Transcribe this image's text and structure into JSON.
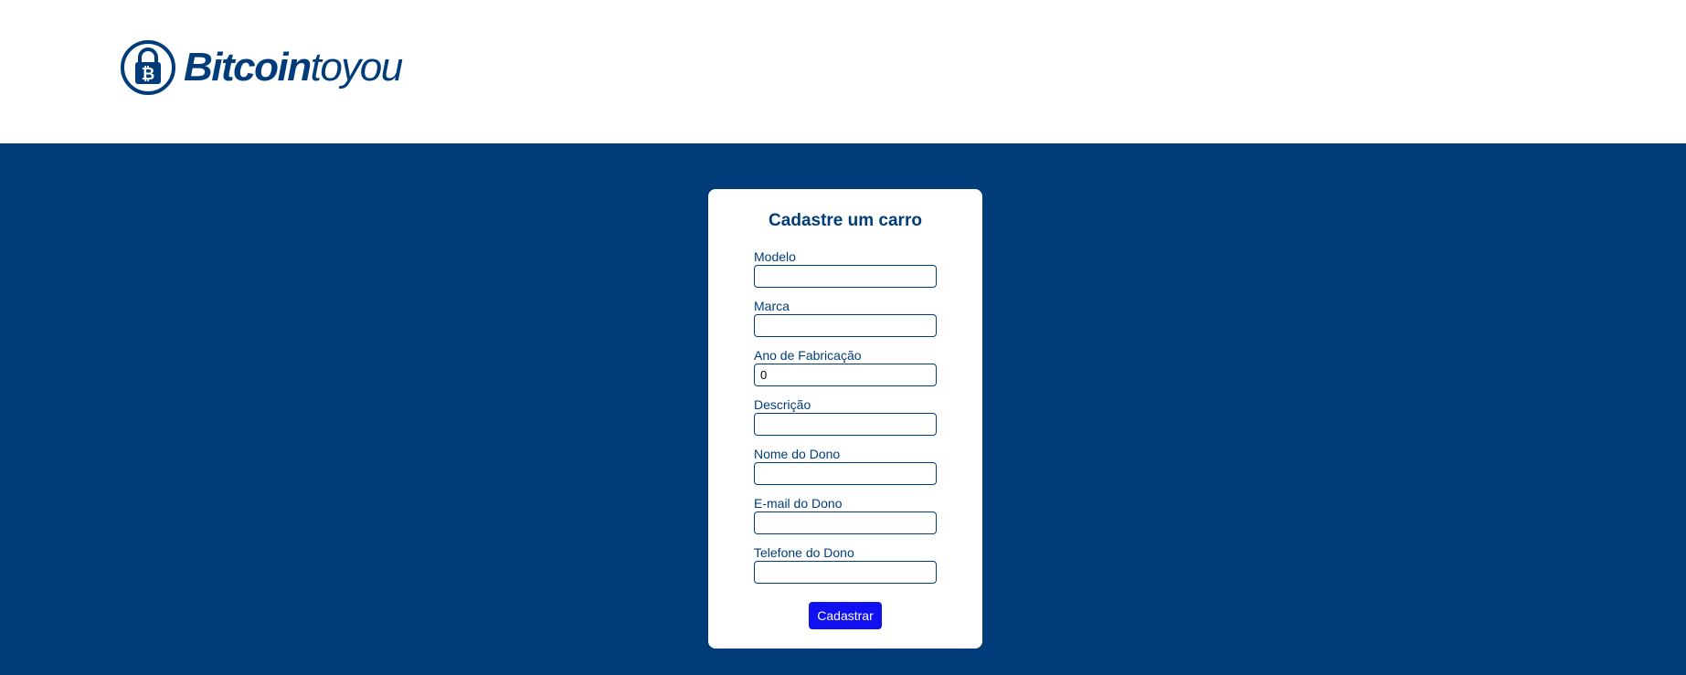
{
  "brand": {
    "name_bold": "Bitcoin",
    "name_light": "toyou",
    "color": "#003c79"
  },
  "form": {
    "title": "Cadastre um carro",
    "fields": [
      {
        "label": "Modelo",
        "value": ""
      },
      {
        "label": "Marca",
        "value": ""
      },
      {
        "label": "Ano de Fabricação",
        "value": "0"
      },
      {
        "label": "Descrição",
        "value": ""
      },
      {
        "label": "Nome do Dono",
        "value": ""
      },
      {
        "label": "E-mail do Dono",
        "value": ""
      },
      {
        "label": "Telefone do Dono",
        "value": ""
      }
    ],
    "submit_label": "Cadastrar"
  },
  "colors": {
    "background": "#003c79",
    "card": "#ffffff",
    "button": "#1010f0"
  }
}
